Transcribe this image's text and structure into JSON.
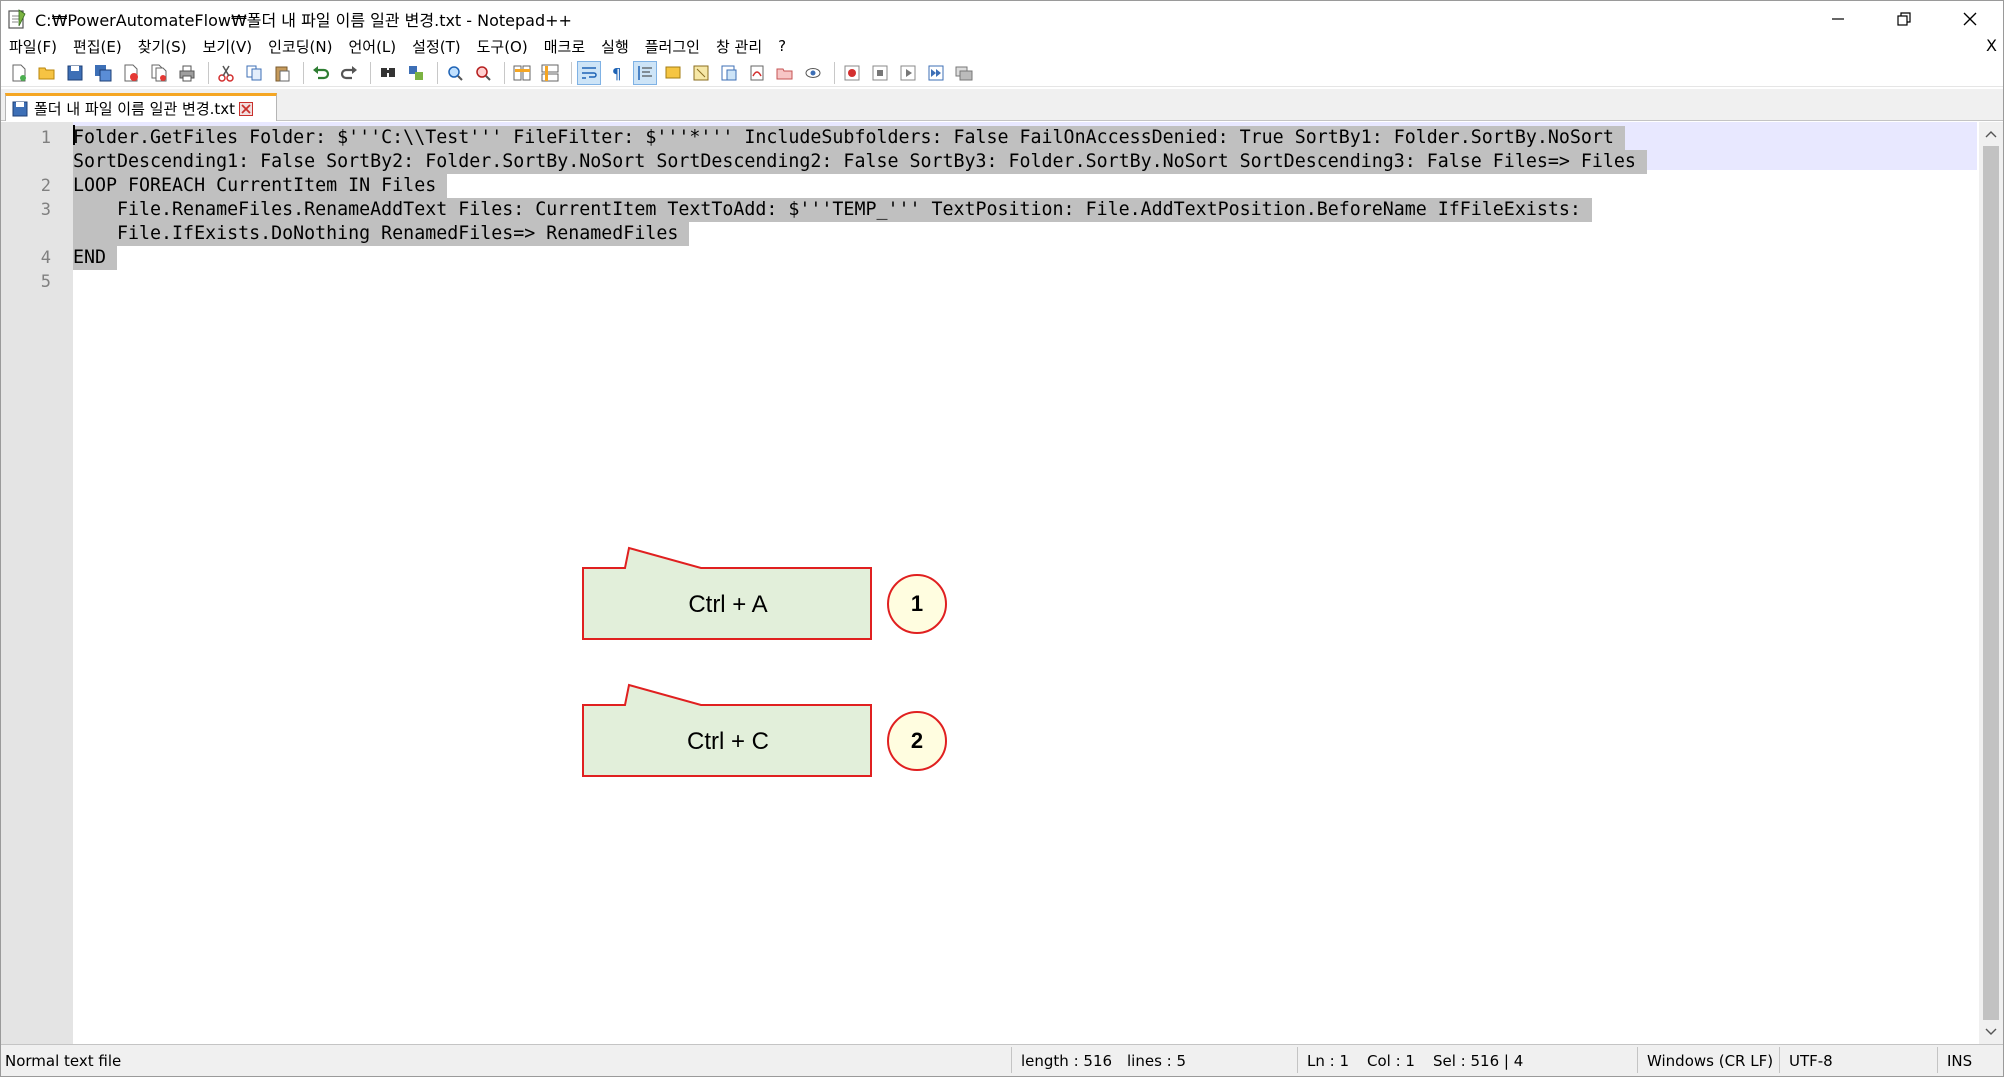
{
  "window": {
    "title": "C:₩PowerAutomateFlow₩폴더 내 파일 이름 일관 변경.txt - Notepad++"
  },
  "menu": {
    "items": [
      "파일(F)",
      "편집(E)",
      "찾기(S)",
      "보기(V)",
      "인코딩(N)",
      "언어(L)",
      "설정(T)",
      "도구(O)",
      "매크로",
      "실행",
      "플러그인",
      "창 관리",
      "?"
    ],
    "close_label": "X"
  },
  "tab": {
    "label": "폴더 내 파일 이름 일관 변경.txt"
  },
  "editor": {
    "line_numbers": [
      "1",
      "2",
      "3",
      "4",
      "5"
    ],
    "lines": [
      "Folder.GetFiles Folder: $'''C:\\\\Test''' FileFilter: $'''*''' IncludeSubfolders: False FailOnAccessDenied: True SortBy1: Folder.SortBy.NoSort ",
      "SortDescending1: False SortBy2: Folder.SortBy.NoSort SortDescending2: False SortBy3: Folder.SortBy.NoSort SortDescending3: False Files=> Files ",
      "LOOP FOREACH CurrentItem IN Files ",
      "    File.RenameFiles.RenameAddText Files: CurrentItem TextToAdd: $'''TEMP_''' TextPosition: File.AddTextPosition.BeforeName IfFileExists: ",
      "    File.IfExists.DoNothing RenamedFiles=> RenamedFiles ",
      "END ",
      ""
    ]
  },
  "callouts": [
    {
      "label": "Ctrl + A",
      "step": "1"
    },
    {
      "label": "Ctrl + C",
      "step": "2"
    }
  ],
  "status": {
    "file_type": "Normal text file",
    "length": "length : 516",
    "lines": "lines : 5",
    "ln": "Ln : 1",
    "col": "Col : 1",
    "sel": "Sel : 516 | 4",
    "eol": "Windows (CR LF)",
    "encoding": "UTF-8",
    "mode": "INS"
  },
  "colors": {
    "selection": "#c0c0c0",
    "current_line": "#e8e8ff",
    "callout_fill": "#e2efda",
    "callout_border": "#e02020",
    "tab_accent": "#f5a623"
  },
  "toolbar_icons": [
    "new-file-icon",
    "open-file-icon",
    "save-icon",
    "save-all-icon",
    "close-icon",
    "close-all-icon",
    "print-icon",
    "cut-icon",
    "copy-icon",
    "paste-icon",
    "undo-icon",
    "redo-icon",
    "find-icon",
    "replace-icon",
    "zoom-in-icon",
    "zoom-out-icon",
    "sync-v-icon",
    "sync-h-icon",
    "word-wrap-icon",
    "show-all-chars-icon",
    "indent-guide-icon",
    "udl-icon",
    "doc-map-icon",
    "function-list-icon",
    "folder-workspace-icon",
    "monitoring-icon",
    "record-macro-icon",
    "stop-record-icon",
    "play-macro-icon",
    "run-macro-multiple-icon",
    "save-macro-icon"
  ]
}
